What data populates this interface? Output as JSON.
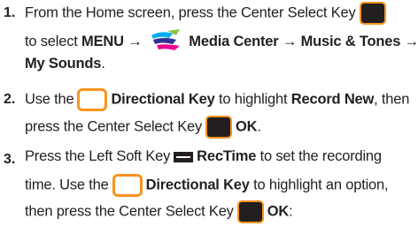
{
  "steps": [
    {
      "number": "1.",
      "line1": {
        "a": "From the Home screen, press the Center Select Key"
      },
      "line2": {
        "a": "to select ",
        "menu": "MENU →",
        "b": "Media Center → Music & Tones →"
      },
      "line3": {
        "a": "My Sounds",
        "b": "."
      }
    },
    {
      "number": "2.",
      "line1": {
        "a": "Use the",
        "b": "Directional Key",
        "c": " to highlight ",
        "d": "Record New",
        "e": ", then"
      },
      "line2": {
        "a": "press the Center Select Key",
        "b": "OK",
        "c": "."
      }
    },
    {
      "number": "3.",
      "line1": {
        "a": "Press the Left Soft Key",
        "b": "RecTime",
        "c": " to set the recording"
      },
      "line2": {
        "a": "time. Use the",
        "b": "Directional Key",
        "c": " to highlight an option,"
      },
      "line3": {
        "a": "then press the Center Select Key",
        "b": "OK",
        "c": ":"
      }
    }
  ],
  "icons": {
    "center_select_key": "center-select-key-icon",
    "directional_key": "directional-key-icon",
    "left_soft_key": "left-soft-key-icon",
    "media_center": "media-center-icon"
  },
  "colors": {
    "text": "#231f20",
    "key_orange": "#f7941d",
    "key_dark": "#231f20"
  }
}
